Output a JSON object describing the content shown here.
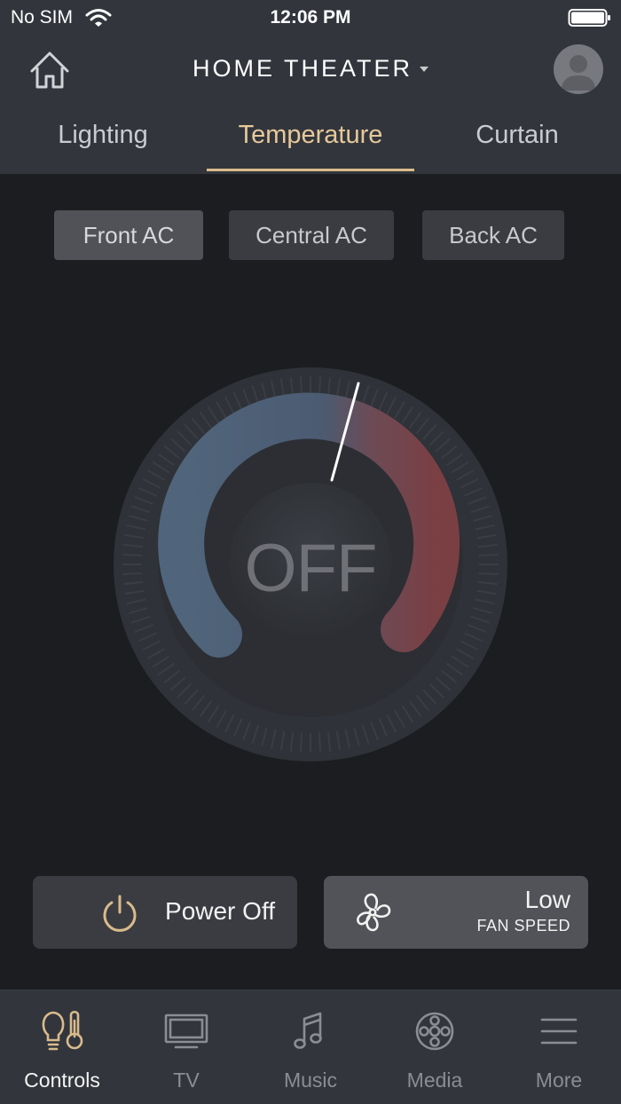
{
  "status": {
    "carrier": "No SIM",
    "time": "12:06 PM"
  },
  "header": {
    "title": "HOME THEATER"
  },
  "tabs": [
    {
      "label": "Lighting",
      "active": false
    },
    {
      "label": "Temperature",
      "active": true
    },
    {
      "label": "Curtain",
      "active": false
    }
  ],
  "ac_units": [
    {
      "label": "Front AC",
      "selected": true
    },
    {
      "label": "Central AC",
      "selected": false
    },
    {
      "label": "Back AC",
      "selected": false
    }
  ],
  "dial": {
    "state": "OFF",
    "cool_color": "#50657b",
    "warm_color": "#7a3f43"
  },
  "power": {
    "label": "Power Off",
    "icon": "power-icon"
  },
  "fan": {
    "value": "Low",
    "caption": "FAN SPEED",
    "icon": "fan-icon"
  },
  "tabbar": [
    {
      "label": "Controls",
      "icon": "controls-icon",
      "active": true
    },
    {
      "label": "TV",
      "icon": "tv-icon",
      "active": false
    },
    {
      "label": "Music",
      "icon": "music-icon",
      "active": false
    },
    {
      "label": "Media",
      "icon": "media-icon",
      "active": false
    },
    {
      "label": "More",
      "icon": "menu-icon",
      "active": false
    }
  ],
  "colors": {
    "accent": "#d9bb8c",
    "header_bg": "#32353c",
    "page_bg": "#1c1d20"
  }
}
